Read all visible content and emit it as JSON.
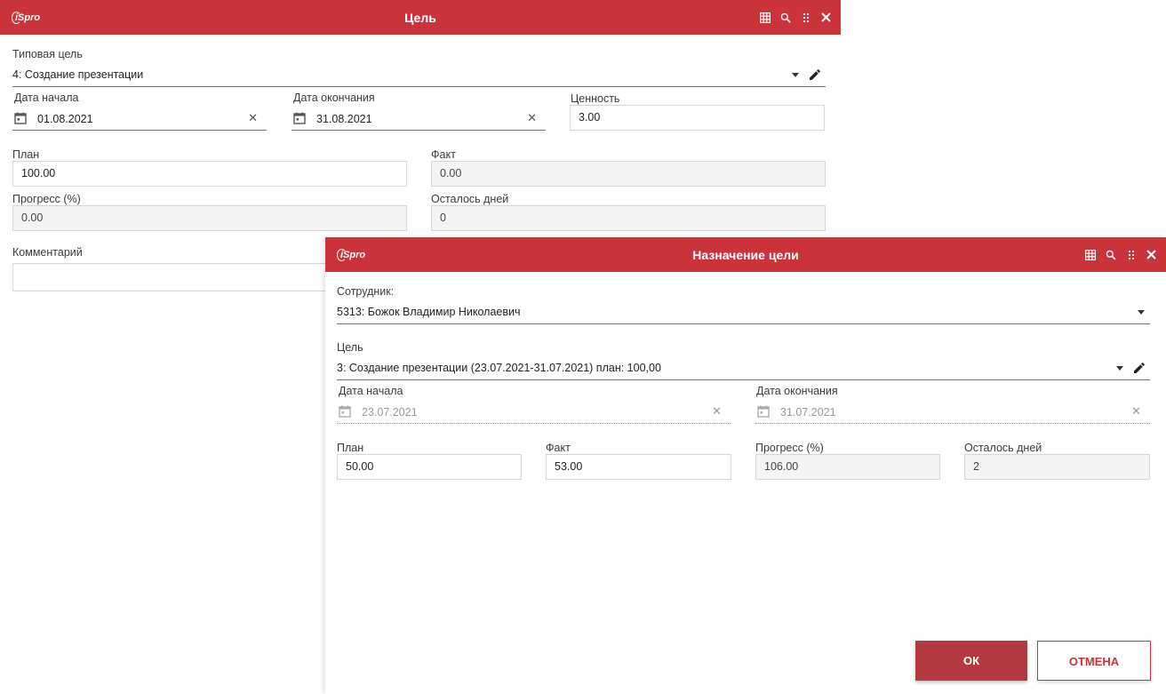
{
  "goal_window": {
    "title": "Цель",
    "logo_text": "iSpro",
    "typical_goal": {
      "label": "Типовая цель",
      "value": "4: Создание презентации"
    },
    "start_date": {
      "label": "Дата начала",
      "value": "01.08.2021"
    },
    "end_date": {
      "label": "Дата окончания",
      "value": "31.08.2021"
    },
    "value_field": {
      "label": "Ценность",
      "value": "3.00"
    },
    "plan": {
      "label": "План",
      "value": "100.00"
    },
    "fact": {
      "label": "Факт",
      "value": "0.00"
    },
    "progress": {
      "label": "Прогресс (%)",
      "value": "0.00"
    },
    "days_left": {
      "label": "Осталось дней",
      "value": "0"
    },
    "comment": {
      "label": "Комментарий",
      "value": ""
    }
  },
  "assign_window": {
    "title": "Назначение цели",
    "logo_text": "iSpro",
    "employee": {
      "label": "Сотрудник:",
      "value": "5313: Божок Владимир Николаевич"
    },
    "goal": {
      "label": "Цель",
      "value": "3: Создание презентации (23.07.2021-31.07.2021) план: 100,00"
    },
    "start_date": {
      "label": "Дата начала",
      "value": "23.07.2021"
    },
    "end_date": {
      "label": "Дата окончания",
      "value": "31.07.2021"
    },
    "plan": {
      "label": "План",
      "value": "50.00"
    },
    "fact": {
      "label": "Факт",
      "value": "53.00"
    },
    "progress": {
      "label": "Прогресс (%)",
      "value": "106.00"
    },
    "days_left": {
      "label": "Осталось дней",
      "value": "2"
    },
    "ok_label": "ОК",
    "cancel_label": "ОТМЕНА"
  },
  "titlebar_icons": [
    "grid-icon",
    "search-icon",
    "drag-handle-icon",
    "close-icon"
  ],
  "colors": {
    "titlebar": "#c9343b",
    "primary_button": "#b33a3f"
  }
}
